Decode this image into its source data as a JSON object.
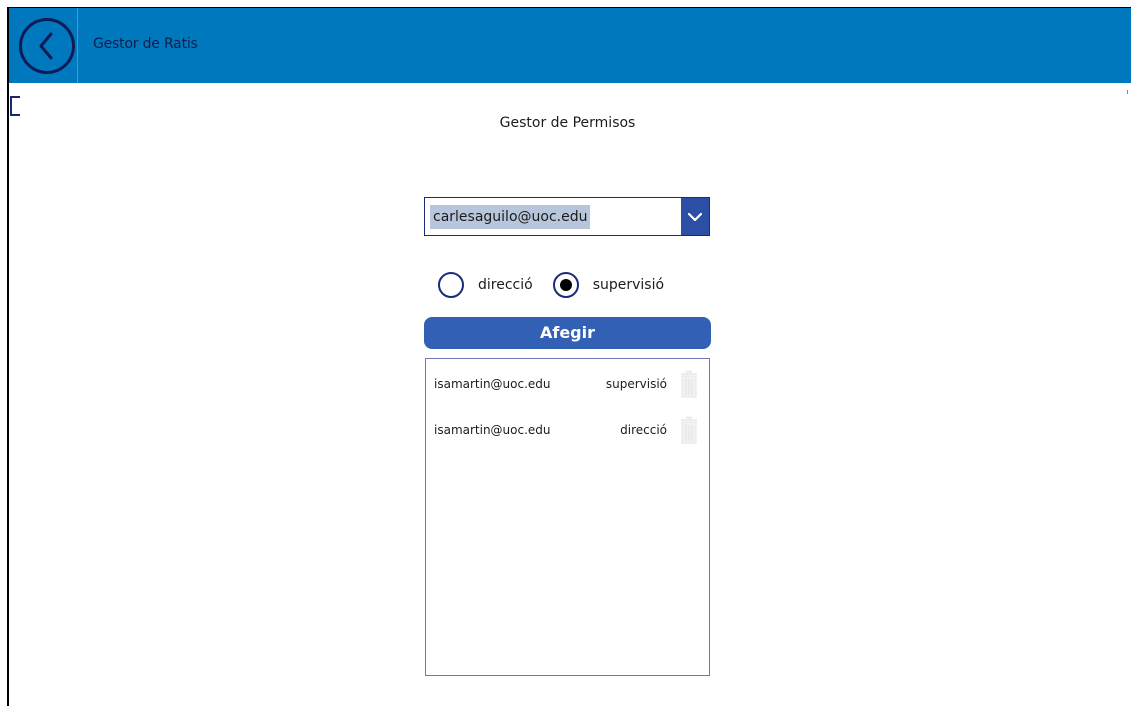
{
  "header": {
    "title": "Gestor de Ratis",
    "back_icon": "chevron-left-icon",
    "color": "#0078bd"
  },
  "main": {
    "title": "Gestor de Permisos",
    "user_select": {
      "selected": "carlesaguilo@uoc.edu",
      "icon": "chevron-down-icon"
    },
    "roles": [
      {
        "label": "direcció",
        "selected": false
      },
      {
        "label": "supervisió",
        "selected": true
      }
    ],
    "add_button": "Afegir",
    "permissions": [
      {
        "email": "isamartin@uoc.edu",
        "role": "supervisió",
        "icon": "trash-icon"
      },
      {
        "email": "isamartin@uoc.edu",
        "role": "direcció",
        "icon": "trash-icon"
      }
    ]
  },
  "colors": {
    "accent": "#3260b5",
    "border": "#1c2b79"
  }
}
